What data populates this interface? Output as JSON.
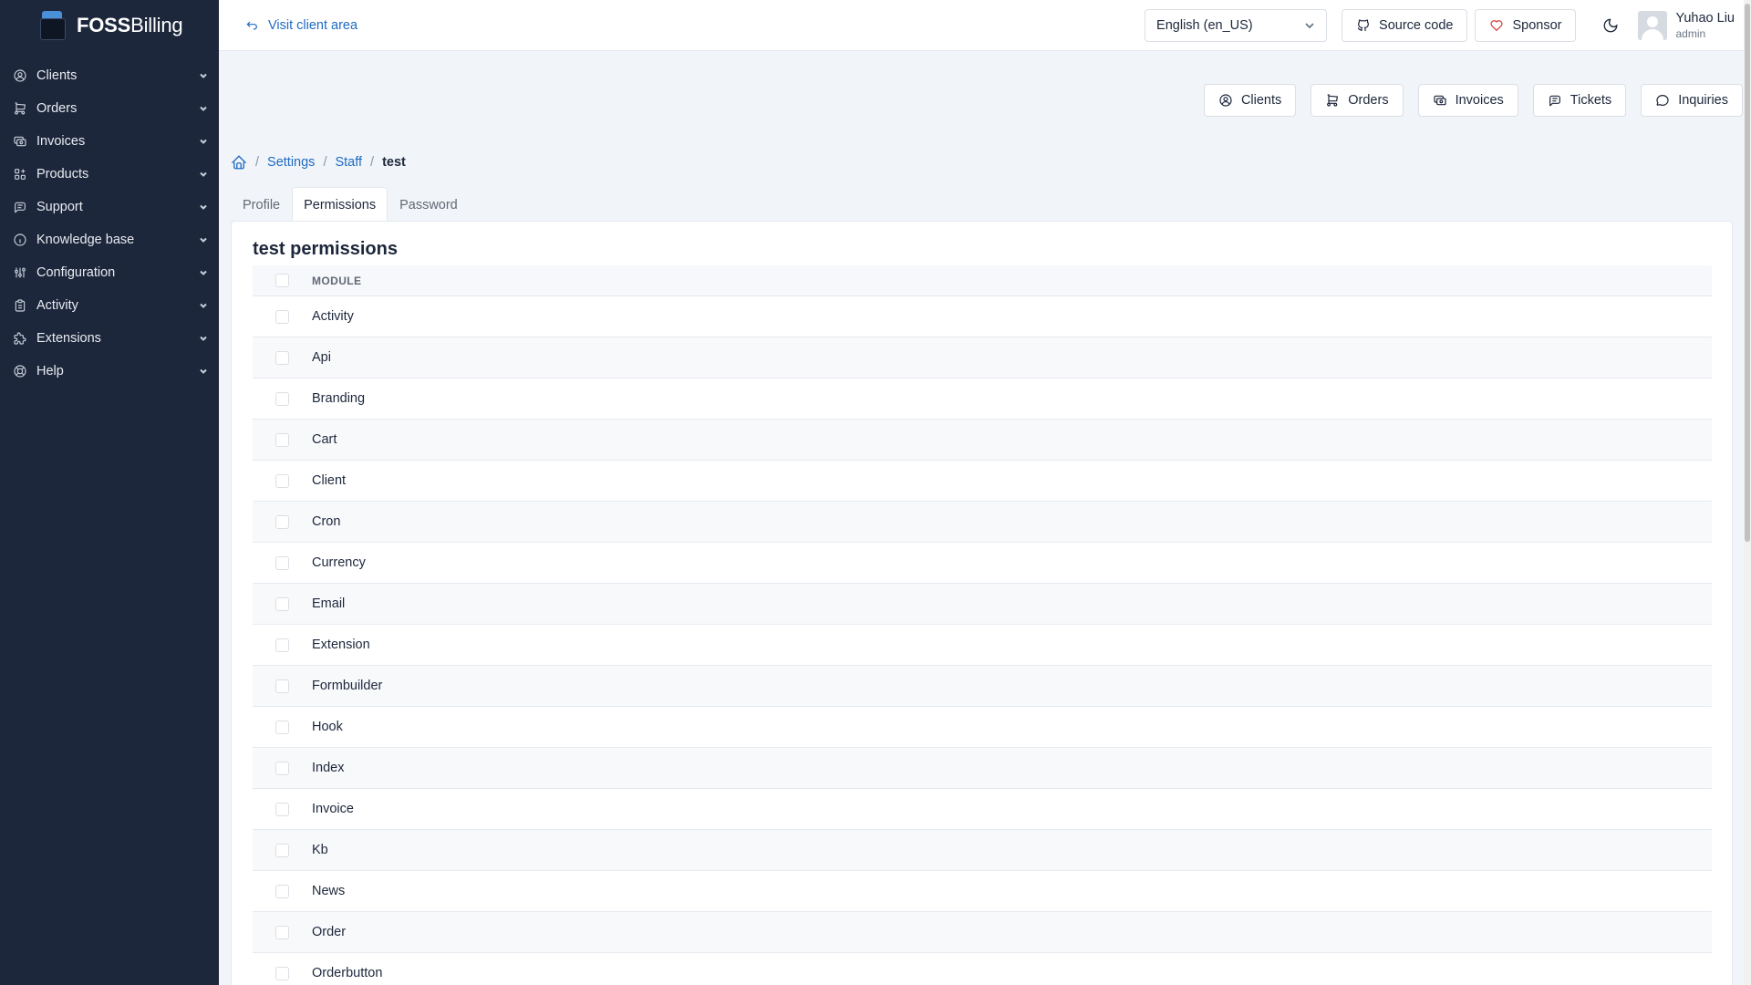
{
  "brand": {
    "bold": "FOSS",
    "rest": "Billing"
  },
  "sidebar": {
    "items": [
      {
        "label": "Clients",
        "icon": "user-circle-icon"
      },
      {
        "label": "Orders",
        "icon": "cart-icon"
      },
      {
        "label": "Invoices",
        "icon": "invoice-icon"
      },
      {
        "label": "Products",
        "icon": "apps-icon"
      },
      {
        "label": "Support",
        "icon": "message-icon"
      },
      {
        "label": "Knowledge base",
        "icon": "info-icon"
      },
      {
        "label": "Configuration",
        "icon": "adjustments-icon"
      },
      {
        "label": "Activity",
        "icon": "clipboard-icon"
      },
      {
        "label": "Extensions",
        "icon": "puzzle-icon"
      },
      {
        "label": "Help",
        "icon": "lifebuoy-icon"
      }
    ]
  },
  "topbar": {
    "visit_label": "Visit client area",
    "language": "English (en_US)",
    "source_label": "Source code",
    "sponsor_label": "Sponsor",
    "user_name": "Yuhao Liu",
    "user_role": "admin"
  },
  "quick": {
    "clients": "Clients",
    "orders": "Orders",
    "invoices": "Invoices",
    "tickets": "Tickets",
    "inquiries": "Inquiries"
  },
  "breadcrumb": {
    "settings": "Settings",
    "staff": "Staff",
    "current": "test"
  },
  "tabs": {
    "profile": "Profile",
    "permissions": "Permissions",
    "password": "Password"
  },
  "card": {
    "title": "test permissions",
    "column_header": "MODULE",
    "modules": [
      "Activity",
      "Api",
      "Branding",
      "Cart",
      "Client",
      "Cron",
      "Currency",
      "Email",
      "Extension",
      "Formbuilder",
      "Hook",
      "Index",
      "Invoice",
      "Kb",
      "News",
      "Order",
      "Orderbutton"
    ]
  },
  "colors": {
    "sidebar_bg": "#1d273b",
    "accent": "#206bc4",
    "page_bg": "#f1f5f9",
    "sponsor_heart": "#d63939"
  }
}
